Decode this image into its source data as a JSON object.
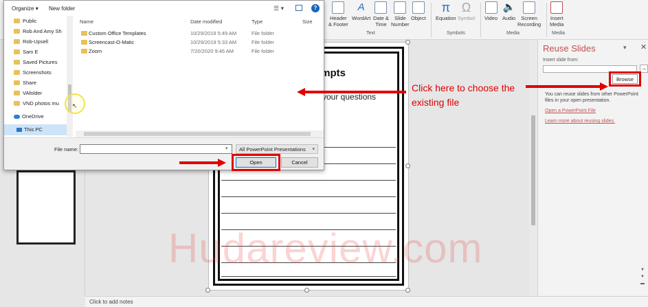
{
  "ribbon": {
    "buttons": [
      {
        "label": "Header\n& Footer",
        "icon": "header-footer-icon"
      },
      {
        "label": "WordArt",
        "icon": "wordart-icon"
      },
      {
        "label": "Date &\nTime",
        "icon": "date-time-icon"
      },
      {
        "label": "Slide\nNumber",
        "icon": "slide-number-icon"
      },
      {
        "label": "Object",
        "icon": "object-icon"
      },
      {
        "label": "Equation",
        "icon": "equation-icon"
      },
      {
        "label": "Symbol",
        "icon": "symbol-icon"
      },
      {
        "label": "Video",
        "icon": "video-icon"
      },
      {
        "label": "Audio",
        "icon": "audio-icon"
      },
      {
        "label": "Screen\nRecording",
        "icon": "screen-recording-icon"
      },
      {
        "label": "Insert\nMedia",
        "icon": "insert-media-icon"
      }
    ],
    "groups": {
      "text": "Text",
      "symbols": "Symbols",
      "media": "Media",
      "media2": "Media"
    }
  },
  "dialog": {
    "organize": "Organize",
    "new_folder": "New folder",
    "nav_items": [
      "Public",
      "Rob And Amy Sh",
      "Rob-Upsell",
      "Sam E",
      "Saved Pictures",
      "Screenshots",
      "Share",
      "VAfolder",
      "VND photos mu",
      "OneDrive",
      "This PC"
    ],
    "columns": {
      "name": "Name",
      "date": "Date modified",
      "type": "Type",
      "size": "Size"
    },
    "files": [
      {
        "name": "Custom Office Templates",
        "date": "10/29/2019 5:49 AM",
        "type": "File folder"
      },
      {
        "name": "Screencast-O-Matic",
        "date": "10/29/2019 5:33 AM",
        "type": "File folder"
      },
      {
        "name": "Zoom",
        "date": "7/20/2020 9:46 AM",
        "type": "File folder"
      }
    ],
    "file_name_label": "File name:",
    "file_name_value": "",
    "file_type": "All PowerPoint Presentations",
    "open_label": "Open",
    "cancel_label": "Cancel"
  },
  "slide": {
    "title": "ompts",
    "subtitle": "your questions"
  },
  "reuse": {
    "title": "Reuse Slides",
    "insert_label": "Insert slide from:",
    "browse_label": "Browse",
    "description": "You can reuse slides from other PowerPoint files in your open presentation.",
    "link_open": "Open a PowerPoint File",
    "link_learn": "Learn more about reusing slides."
  },
  "notes": {
    "placeholder": "Click to add notes"
  },
  "annotation": {
    "callout": "Click here to choose the existing file"
  },
  "watermark": "Hudareview.com",
  "colors": {
    "accent": "#c0504d",
    "annotation": "#e00000",
    "primary_button_border": "#0078d7"
  }
}
